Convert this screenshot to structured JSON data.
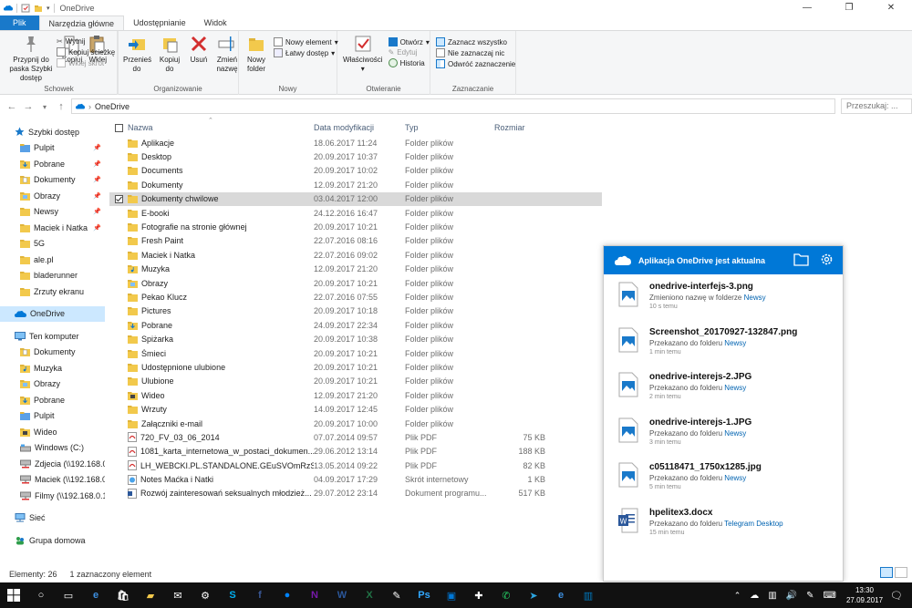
{
  "window": {
    "title": "OneDrive",
    "controls": [
      "—",
      "❐",
      "✕"
    ]
  },
  "ribbon": {
    "tabs": [
      {
        "label": "Plik",
        "kind": "file"
      },
      {
        "label": "Narzędzia główne",
        "kind": "active"
      },
      {
        "label": "Udostępnianie",
        "kind": "normal"
      },
      {
        "label": "Widok",
        "kind": "normal"
      }
    ],
    "schowek": {
      "label": "Schowek",
      "pin": "Przypnij do paska Szybki dostęp",
      "copy": "Kopiuj",
      "paste": "Wklej",
      "cut": "Wytnij",
      "copy_path": "Kopiuj ścieżkę",
      "paste_shortcut": "Wklej skrót"
    },
    "organizuj": {
      "label": "Organizowanie",
      "move": "Przenieś do",
      "copy_to": "Kopiuj do",
      "delete": "Usuń",
      "rename": "Zmień nazwę"
    },
    "nowy": {
      "label": "Nowy",
      "new_folder": "Nowy folder",
      "new_item": "Nowy element",
      "easy_access": "Łatwy dostęp"
    },
    "otwieranie": {
      "label": "Otwieranie",
      "properties": "Właściwości",
      "open": "Otwórz",
      "edit": "Edytuj",
      "history": "Historia"
    },
    "zaznaczanie": {
      "label": "Zaznaczanie",
      "select_all": "Zaznacz wszystko",
      "select_none": "Nie zaznaczaj nic",
      "invert": "Odwróć zaznaczenie"
    }
  },
  "address": {
    "path": "OneDrive",
    "search_placeholder": "Przeszukaj: ..."
  },
  "nav": {
    "items": [
      {
        "label": "Szybki dostęp",
        "icon": "star-icon",
        "indent": 1,
        "pinned": false,
        "selected": false,
        "gap_before": false
      },
      {
        "label": "Pulpit",
        "icon": "folder-blue-icon",
        "indent": 2,
        "pinned": true,
        "selected": false,
        "gap_before": false
      },
      {
        "label": "Pobrane",
        "icon": "download-folder-icon",
        "indent": 2,
        "pinned": true,
        "selected": false,
        "gap_before": false
      },
      {
        "label": "Dokumenty",
        "icon": "documents-folder-icon",
        "indent": 2,
        "pinned": true,
        "selected": false,
        "gap_before": false
      },
      {
        "label": "Obrazy",
        "icon": "pictures-folder-icon",
        "indent": 2,
        "pinned": true,
        "selected": false,
        "gap_before": false
      },
      {
        "label": "Newsy",
        "icon": "folder-icon",
        "indent": 2,
        "pinned": true,
        "selected": false,
        "gap_before": false
      },
      {
        "label": "Maciek i Natka",
        "icon": "folder-icon",
        "indent": 2,
        "pinned": true,
        "selected": false,
        "gap_before": false
      },
      {
        "label": "5G",
        "icon": "folder-icon",
        "indent": 2,
        "pinned": false,
        "selected": false,
        "gap_before": false
      },
      {
        "label": "ale.pl",
        "icon": "folder-icon",
        "indent": 2,
        "pinned": false,
        "selected": false,
        "gap_before": false
      },
      {
        "label": "bladerunner",
        "icon": "folder-icon",
        "indent": 2,
        "pinned": false,
        "selected": false,
        "gap_before": false
      },
      {
        "label": "Zrzuty ekranu",
        "icon": "folder-icon",
        "indent": 2,
        "pinned": false,
        "selected": false,
        "gap_before": false
      },
      {
        "label": "OneDrive",
        "icon": "onedrive-icon",
        "indent": 1,
        "pinned": false,
        "selected": true,
        "gap_before": true
      },
      {
        "label": "Ten komputer",
        "icon": "computer-icon",
        "indent": 1,
        "pinned": false,
        "selected": false,
        "gap_before": true
      },
      {
        "label": "Dokumenty",
        "icon": "documents-folder-icon",
        "indent": 2,
        "pinned": false,
        "selected": false,
        "gap_before": false
      },
      {
        "label": "Muzyka",
        "icon": "music-folder-icon",
        "indent": 2,
        "pinned": false,
        "selected": false,
        "gap_before": false
      },
      {
        "label": "Obrazy",
        "icon": "pictures-folder-icon",
        "indent": 2,
        "pinned": false,
        "selected": false,
        "gap_before": false
      },
      {
        "label": "Pobrane",
        "icon": "download-folder-icon",
        "indent": 2,
        "pinned": false,
        "selected": false,
        "gap_before": false
      },
      {
        "label": "Pulpit",
        "icon": "folder-blue-icon",
        "indent": 2,
        "pinned": false,
        "selected": false,
        "gap_before": false
      },
      {
        "label": "Wideo",
        "icon": "video-folder-icon",
        "indent": 2,
        "pinned": false,
        "selected": false,
        "gap_before": false
      },
      {
        "label": "Windows (C:)",
        "icon": "drive-icon",
        "indent": 2,
        "pinned": false,
        "selected": false,
        "gap_before": false
      },
      {
        "label": "Zdjecia (\\\\192.168.0.1",
        "icon": "network-drive-icon",
        "indent": 2,
        "pinned": false,
        "selected": false,
        "gap_before": false
      },
      {
        "label": "Maciek (\\\\192.168.0.",
        "icon": "network-drive-icon",
        "indent": 2,
        "pinned": false,
        "selected": false,
        "gap_before": false
      },
      {
        "label": "Filmy (\\\\192.168.0.10",
        "icon": "network-drive-icon",
        "indent": 2,
        "pinned": false,
        "selected": false,
        "gap_before": false
      },
      {
        "label": "Sieć",
        "icon": "network-icon",
        "indent": 1,
        "pinned": false,
        "selected": false,
        "gap_before": true
      },
      {
        "label": "Grupa domowa",
        "icon": "homegroup-icon",
        "indent": 1,
        "pinned": false,
        "selected": false,
        "gap_before": true
      }
    ]
  },
  "filelist": {
    "columns": {
      "name": "Nazwa",
      "date": "Data modyfikacji",
      "type": "Typ",
      "size": "Rozmiar"
    },
    "rows": [
      {
        "name": "Aplikacje",
        "date": "18.06.2017 11:24",
        "type": "Folder plików",
        "size": "",
        "icon": "folder",
        "selected": false
      },
      {
        "name": "Desktop",
        "date": "20.09.2017 10:37",
        "type": "Folder plików",
        "size": "",
        "icon": "folder",
        "selected": false
      },
      {
        "name": "Documents",
        "date": "20.09.2017 10:02",
        "type": "Folder plików",
        "size": "",
        "icon": "folder",
        "selected": false
      },
      {
        "name": "Dokumenty",
        "date": "12.09.2017 21:20",
        "type": "Folder plików",
        "size": "",
        "icon": "folder",
        "selected": false
      },
      {
        "name": "Dokumenty chwilowe",
        "date": "03.04.2017 12:00",
        "type": "Folder plików",
        "size": "",
        "icon": "folder",
        "selected": true
      },
      {
        "name": "E-booki",
        "date": "24.12.2016 16:47",
        "type": "Folder plików",
        "size": "",
        "icon": "folder",
        "selected": false
      },
      {
        "name": "Fotografie na stronie głównej",
        "date": "20.09.2017 10:21",
        "type": "Folder plików",
        "size": "",
        "icon": "folder",
        "selected": false
      },
      {
        "name": "Fresh Paint",
        "date": "22.07.2016 08:16",
        "type": "Folder plików",
        "size": "",
        "icon": "folder",
        "selected": false
      },
      {
        "name": "Maciek i Natka",
        "date": "22.07.2016 09:02",
        "type": "Folder plików",
        "size": "",
        "icon": "folder",
        "selected": false
      },
      {
        "name": "Muzyka",
        "date": "12.09.2017 21:20",
        "type": "Folder plików",
        "size": "",
        "icon": "music",
        "selected": false
      },
      {
        "name": "Obrazy",
        "date": "20.09.2017 10:21",
        "type": "Folder plików",
        "size": "",
        "icon": "pictures",
        "selected": false
      },
      {
        "name": "Pekao Klucz",
        "date": "22.07.2016 07:55",
        "type": "Folder plików",
        "size": "",
        "icon": "folder",
        "selected": false
      },
      {
        "name": "Pictures",
        "date": "20.09.2017 10:18",
        "type": "Folder plików",
        "size": "",
        "icon": "folder",
        "selected": false
      },
      {
        "name": "Pobrane",
        "date": "24.09.2017 22:34",
        "type": "Folder plików",
        "size": "",
        "icon": "download",
        "selected": false
      },
      {
        "name": "Spiżarka",
        "date": "20.09.2017 10:38",
        "type": "Folder plików",
        "size": "",
        "icon": "folder",
        "selected": false
      },
      {
        "name": "Śmieci",
        "date": "20.09.2017 10:21",
        "type": "Folder plików",
        "size": "",
        "icon": "folder",
        "selected": false
      },
      {
        "name": "Udostępnione ulubione",
        "date": "20.09.2017 10:21",
        "type": "Folder plików",
        "size": "",
        "icon": "folder",
        "selected": false
      },
      {
        "name": "Ulubione",
        "date": "20.09.2017 10:21",
        "type": "Folder plików",
        "size": "",
        "icon": "folder",
        "selected": false
      },
      {
        "name": "Wideo",
        "date": "12.09.2017 21:20",
        "type": "Folder plików",
        "size": "",
        "icon": "video",
        "selected": false
      },
      {
        "name": "Wrzuty",
        "date": "14.09.2017 12:45",
        "type": "Folder plików",
        "size": "",
        "icon": "folder",
        "selected": false
      },
      {
        "name": "Załączniki e-mail",
        "date": "20.09.2017 10:00",
        "type": "Folder plików",
        "size": "",
        "icon": "folder",
        "selected": false
      },
      {
        "name": "720_FV_03_06_2014",
        "date": "07.07.2014 09:57",
        "type": "Plik PDF",
        "size": "75 KB",
        "icon": "pdf",
        "selected": false
      },
      {
        "name": "1081_karta_internetowa_w_postaci_dokumen...",
        "date": "29.06.2012 13:14",
        "type": "Plik PDF",
        "size": "188 KB",
        "icon": "pdf",
        "selected": false
      },
      {
        "name": "LH_WEBCKI.PL.STANDALONE.GEuSVOmRzSo...",
        "date": "13.05.2014 09:22",
        "type": "Plik PDF",
        "size": "82 KB",
        "icon": "pdf",
        "selected": false
      },
      {
        "name": "Notes Maćka i Natki",
        "date": "04.09.2017 17:29",
        "type": "Skrót internetowy",
        "size": "1 KB",
        "icon": "link",
        "selected": false
      },
      {
        "name": "Rozwój zainteresowań seksualnych młodzież...",
        "date": "29.07.2012 23:14",
        "type": "Dokument programu...",
        "size": "517 KB",
        "icon": "doc",
        "selected": false
      }
    ]
  },
  "status": {
    "count": "Elementy: 26",
    "selected": "1 zaznaczony element"
  },
  "onedrive": {
    "header": "Aplikacja OneDrive jest aktualna",
    "items": [
      {
        "name": "onedrive-interfejs-3.png",
        "action": "Zmieniono nazwę w folderze",
        "folder": "Newsy",
        "time": "10 s temu",
        "icon": "image"
      },
      {
        "name": "Screenshot_20170927-132847.png",
        "action": "Przekazano do folderu",
        "folder": "Newsy",
        "time": "1 min temu",
        "icon": "image"
      },
      {
        "name": "onedrive-interejs-2.JPG",
        "action": "Przekazano do folderu",
        "folder": "Newsy",
        "time": "2 min temu",
        "icon": "image"
      },
      {
        "name": "onedrive-interejs-1.JPG",
        "action": "Przekazano do folderu",
        "folder": "Newsy",
        "time": "3 min temu",
        "icon": "image"
      },
      {
        "name": "c05118471_1750x1285.jpg",
        "action": "Przekazano do folderu",
        "folder": "Newsy",
        "time": "5 min temu",
        "icon": "image"
      },
      {
        "name": "hpelitex3.docx",
        "action": "Przekazano do folderu",
        "folder": "Telegram Desktop",
        "time": "15 min temu",
        "icon": "word"
      }
    ]
  },
  "taskbar": {
    "apps": [
      {
        "name": "cortana",
        "color": "#ffffff",
        "glyph": "○"
      },
      {
        "name": "task-view",
        "color": "#ffffff",
        "glyph": "▭"
      },
      {
        "name": "edge",
        "color": "#3d8fe0",
        "glyph": "e"
      },
      {
        "name": "store",
        "color": "#ffffff",
        "glyph": "🛍"
      },
      {
        "name": "explorer",
        "color": "#f2c94c",
        "glyph": "▰"
      },
      {
        "name": "mail",
        "color": "#ffffff",
        "glyph": "✉"
      },
      {
        "name": "settings",
        "color": "#ffffff",
        "glyph": "⚙"
      },
      {
        "name": "skype",
        "color": "#00aff0",
        "glyph": "S"
      },
      {
        "name": "facebook",
        "color": "#3b5998",
        "glyph": "f"
      },
      {
        "name": "messenger",
        "color": "#0084ff",
        "glyph": "●"
      },
      {
        "name": "onenote",
        "color": "#7719aa",
        "glyph": "N"
      },
      {
        "name": "word",
        "color": "#2b579a",
        "glyph": "W"
      },
      {
        "name": "excel",
        "color": "#217346",
        "glyph": "X"
      },
      {
        "name": "paint",
        "color": "#ffffff",
        "glyph": "✎"
      },
      {
        "name": "photoshop",
        "color": "#31a8ff",
        "glyph": "Ps"
      },
      {
        "name": "pictures",
        "color": "#0078d7",
        "glyph": "▣"
      },
      {
        "name": "extension",
        "color": "#ffffff",
        "glyph": "✚"
      },
      {
        "name": "whatsapp",
        "color": "#25d366",
        "glyph": "✆"
      },
      {
        "name": "telegram",
        "color": "#2ca5e0",
        "glyph": "➤"
      },
      {
        "name": "edge-2",
        "color": "#3d8fe0",
        "glyph": "e"
      },
      {
        "name": "trello",
        "color": "#0079bf",
        "glyph": "▥"
      }
    ],
    "time": "13:30",
    "date": "27.09.2017"
  },
  "colors": {
    "accent": "#0078d7",
    "file_tab": "#1979ca",
    "selection": "#cce8ff",
    "row_selected": "#d9d9d9",
    "link": "#0063b1"
  }
}
